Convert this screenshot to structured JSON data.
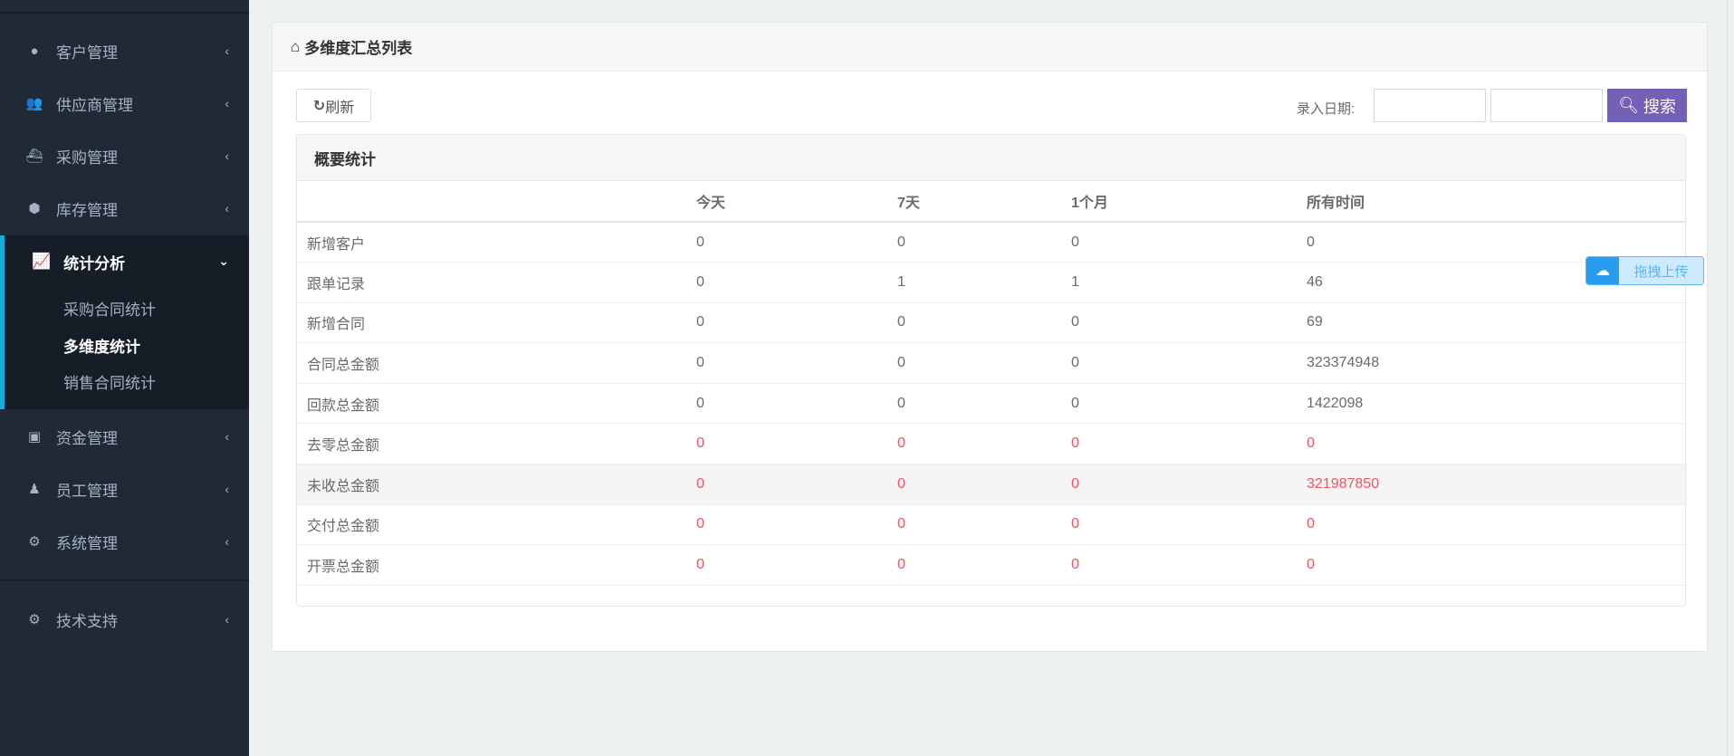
{
  "sidebar": {
    "items": [
      {
        "label": "客户管理",
        "icon": "user-icon"
      },
      {
        "label": "供应商管理",
        "icon": "users-icon"
      },
      {
        "label": "采购管理",
        "icon": "purchase-icon"
      },
      {
        "label": "库存管理",
        "icon": "cube-icon"
      }
    ],
    "active": {
      "label": "统计分析",
      "icon": "line-chart-icon",
      "children": [
        "采购合同统计",
        "多维度统计",
        "销售合同统计"
      ]
    },
    "items_after": [
      {
        "label": "资金管理",
        "icon": "money-icon"
      },
      {
        "label": "员工管理",
        "icon": "employee-icon"
      },
      {
        "label": "系统管理",
        "icon": "cogs-icon"
      }
    ],
    "support": {
      "label": "技术支持",
      "icon": "cogs-icon"
    }
  },
  "panel": {
    "title": "多维度汇总列表",
    "refresh_label": "刷新",
    "date_label": "录入日期:",
    "date_from": "",
    "date_to": "",
    "search_label": "搜索"
  },
  "summary": {
    "title": "概要统计",
    "headers": [
      "",
      "今天",
      "7天",
      "1个月",
      "所有时间"
    ],
    "rows": [
      {
        "label": "新增客户",
        "values": [
          "0",
          "0",
          "0",
          "0"
        ]
      },
      {
        "label": "跟单记录",
        "values": [
          "0",
          "1",
          "1",
          "46"
        ]
      },
      {
        "label": "新增合同",
        "values": [
          "0",
          "0",
          "0",
          "69"
        ]
      },
      {
        "label": "合同总金额",
        "values": [
          "0",
          "0",
          "0",
          "323374948"
        ]
      },
      {
        "label": "回款总金额",
        "values": [
          "0",
          "0",
          "0",
          "1422098"
        ]
      },
      {
        "label": "去零总金额",
        "values": [
          "0",
          "0",
          "0",
          "0"
        ]
      },
      {
        "label": "未收总金额",
        "values": [
          "0",
          "0",
          "0",
          "321987850"
        ]
      },
      {
        "label": "交付总金额",
        "values": [
          "0",
          "0",
          "0",
          "0"
        ]
      },
      {
        "label": "开票总金额",
        "values": [
          "0",
          "0",
          "0",
          "0"
        ]
      }
    ]
  },
  "upload_widget": {
    "label": "拖拽上传"
  },
  "colors": {
    "accent": "#7361b8",
    "danger": "#ed5565",
    "sidebar": "#1f2a36",
    "active_border": "#19aadc"
  }
}
